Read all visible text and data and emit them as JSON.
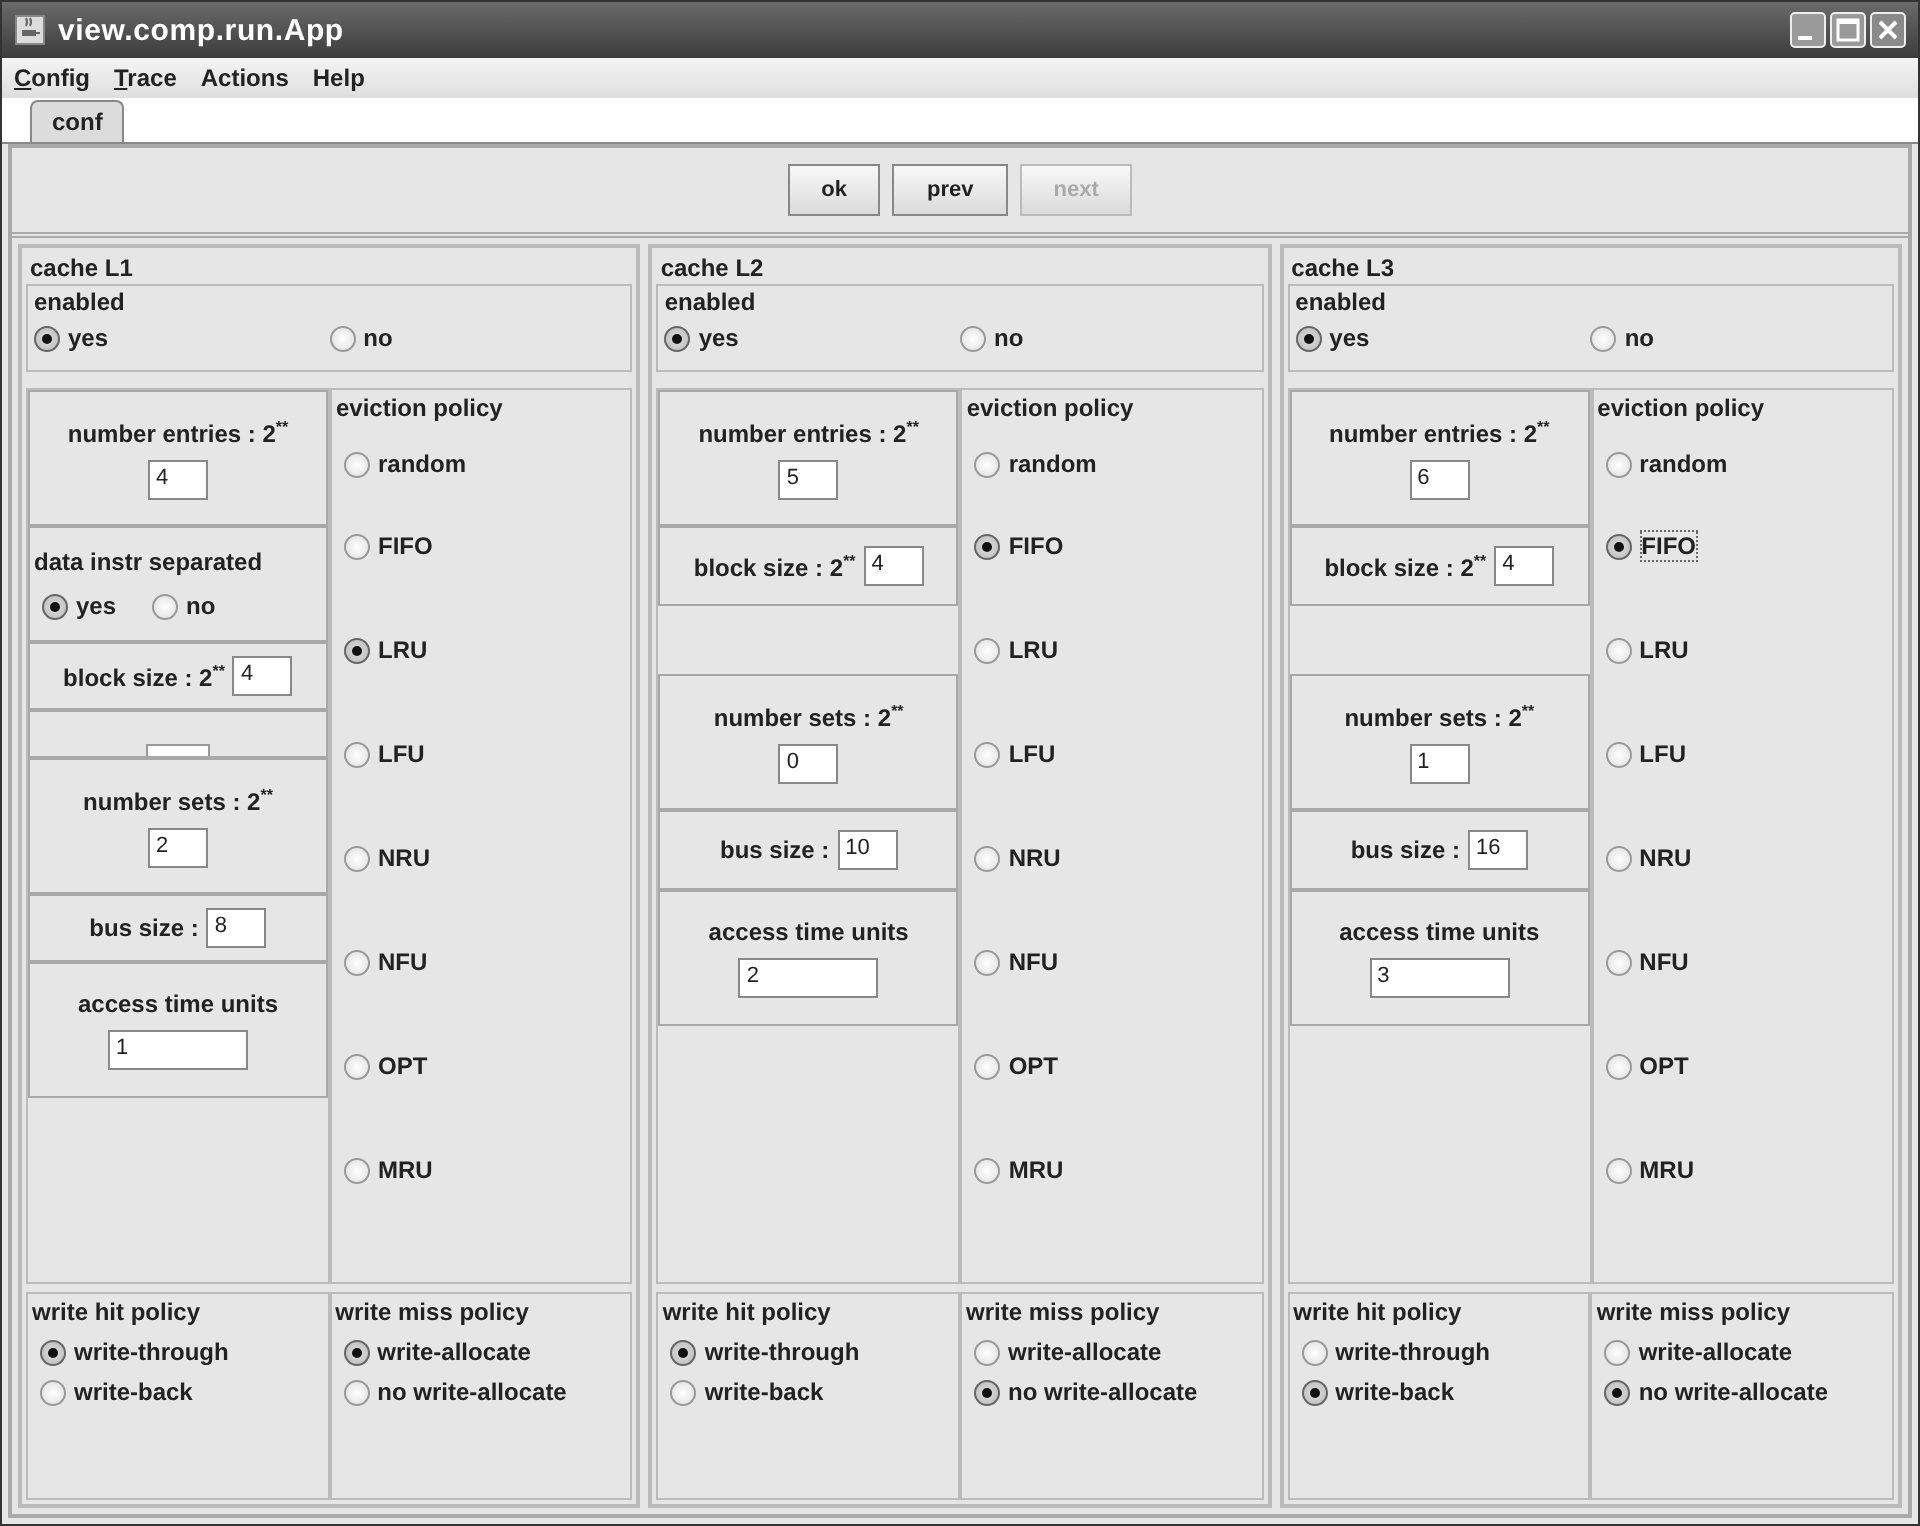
{
  "window": {
    "title": "view.comp.run.App"
  },
  "menu": [
    {
      "label": "Config",
      "underline_first": true
    },
    {
      "label": "Trace",
      "underline_first": true
    },
    {
      "label": "Actions",
      "underline_first": false
    },
    {
      "label": "Help",
      "underline_first": false
    }
  ],
  "tabs": [
    {
      "label": "conf",
      "selected": true
    }
  ],
  "buttons": [
    {
      "label": "ok",
      "disabled": false
    },
    {
      "label": "prev",
      "disabled": false
    },
    {
      "label": "next",
      "disabled": true
    }
  ],
  "caches": [
    {
      "title": "cache L1",
      "enabled": {
        "title": "enabled",
        "options": [
          {
            "label": "yes",
            "selected": true
          },
          {
            "label": "no",
            "selected": false
          }
        ]
      },
      "settings": [
        {
          "kind": "stacked",
          "label": "number entries : 2$^{**}$",
          "value": "4"
        },
        {
          "kind": "radio",
          "label": "data instr separated",
          "options": [
            {
              "label": "yes",
              "selected": true
            },
            {
              "label": "no",
              "selected": false
            }
          ]
        },
        {
          "kind": "inline",
          "label": "block size : 2$^{**}$",
          "value": "4"
        },
        {
          "kind": "strip"
        },
        {
          "kind": "stacked",
          "label": "number sets : 2$^{**}$",
          "value": "2"
        },
        {
          "kind": "inline",
          "label": "bus size :",
          "value": "8"
        },
        {
          "kind": "wide",
          "label": "access time units",
          "value": "1"
        }
      ],
      "eviction": {
        "title": "eviction policy",
        "options": [
          {
            "label": "random",
            "selected": false
          },
          {
            "label": "FIFO",
            "selected": false
          },
          {
            "label": "LRU",
            "selected": true
          },
          {
            "label": "LFU",
            "selected": false
          },
          {
            "label": "NRU",
            "selected": false
          },
          {
            "label": "NFU",
            "selected": false
          },
          {
            "label": "OPT",
            "selected": false
          },
          {
            "label": "MRU",
            "selected": false
          }
        ]
      },
      "write_hit": {
        "title": "write hit policy",
        "options": [
          {
            "label": "write-through",
            "selected": true
          },
          {
            "label": "write-back",
            "selected": false
          }
        ]
      },
      "write_miss": {
        "title": "write miss policy",
        "options": [
          {
            "label": "write-allocate",
            "selected": true
          },
          {
            "label": "no write-allocate",
            "selected": false
          }
        ]
      }
    },
    {
      "title": "cache L2",
      "enabled": {
        "title": "enabled",
        "options": [
          {
            "label": "yes",
            "selected": true
          },
          {
            "label": "no",
            "selected": false
          }
        ]
      },
      "settings": [
        {
          "kind": "stacked",
          "label": "number entries : 2$^{**}$",
          "value": "5"
        },
        {
          "kind": "inline",
          "label": "block size : 2$^{**}$",
          "value": "4"
        },
        {
          "kind": "blank"
        },
        {
          "kind": "stacked",
          "label": "number sets : 2$^{**}$",
          "value": "0"
        },
        {
          "kind": "inline",
          "label": "bus size :",
          "value": "10"
        },
        {
          "kind": "wide",
          "label": "access time units",
          "value": "2"
        }
      ],
      "eviction": {
        "title": "eviction policy",
        "options": [
          {
            "label": "random",
            "selected": false
          },
          {
            "label": "FIFO",
            "selected": true
          },
          {
            "label": "LRU",
            "selected": false
          },
          {
            "label": "LFU",
            "selected": false
          },
          {
            "label": "NRU",
            "selected": false
          },
          {
            "label": "NFU",
            "selected": false
          },
          {
            "label": "OPT",
            "selected": false
          },
          {
            "label": "MRU",
            "selected": false
          }
        ]
      },
      "write_hit": {
        "title": "write hit policy",
        "options": [
          {
            "label": "write-through",
            "selected": true
          },
          {
            "label": "write-back",
            "selected": false
          }
        ]
      },
      "write_miss": {
        "title": "write miss policy",
        "options": [
          {
            "label": "write-allocate",
            "selected": false
          },
          {
            "label": "no write-allocate",
            "selected": true
          }
        ]
      }
    },
    {
      "title": "cache L3",
      "enabled": {
        "title": "enabled",
        "options": [
          {
            "label": "yes",
            "selected": true
          },
          {
            "label": "no",
            "selected": false
          }
        ]
      },
      "settings": [
        {
          "kind": "stacked",
          "label": "number entries : 2$^{**}$",
          "value": "6"
        },
        {
          "kind": "inline",
          "label": "block size : 2$^{**}$",
          "value": "4"
        },
        {
          "kind": "blank"
        },
        {
          "kind": "stacked",
          "label": "number sets : 2$^{**}$",
          "value": "1"
        },
        {
          "kind": "inline",
          "label": "bus size :",
          "value": "16"
        },
        {
          "kind": "wide",
          "label": "access time units",
          "value": "3"
        }
      ],
      "eviction": {
        "title": "eviction policy",
        "options": [
          {
            "label": "random",
            "selected": false
          },
          {
            "label": "FIFO",
            "selected": true
          },
          {
            "label": "LRU",
            "selected": false
          },
          {
            "label": "LFU",
            "selected": false
          },
          {
            "label": "NRU",
            "selected": false
          },
          {
            "label": "NFU",
            "selected": false
          },
          {
            "label": "OPT",
            "selected": false
          },
          {
            "label": "MRU",
            "selected": false
          }
        ]
      },
      "write_hit": {
        "title": "write hit policy",
        "options": [
          {
            "label": "write-through",
            "selected": false
          },
          {
            "label": "write-back",
            "selected": true
          }
        ]
      },
      "write_miss": {
        "title": "write miss policy",
        "options": [
          {
            "label": "write-allocate",
            "selected": false
          },
          {
            "label": "no write-allocate",
            "selected": true
          }
        ]
      }
    }
  ]
}
